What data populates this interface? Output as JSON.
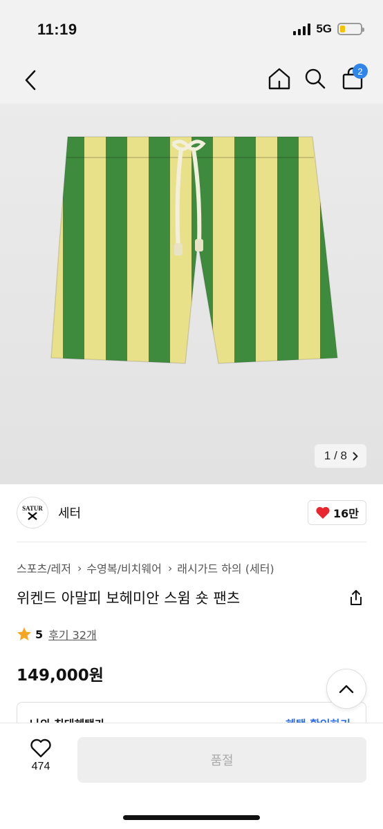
{
  "status_bar": {
    "time": "11:19",
    "network": "5G",
    "battery_level": 0.25
  },
  "nav": {
    "cart_count": "2"
  },
  "image": {
    "counter": "1 / 8",
    "stripe_colors": [
      "#e9e08a",
      "#3f8b3e"
    ]
  },
  "brand": {
    "logo_text": "SATUR",
    "name": "세터",
    "likes": "16만"
  },
  "breadcrumb": [
    "스포츠/레저",
    "수영복/비치웨어",
    "래시가드 하의 (세터)"
  ],
  "product": {
    "title": "위켄드 아말피 보헤미안 스윔 숏 팬츠",
    "rating": "5",
    "reviews": "후기 32개",
    "price": "149,000원"
  },
  "benefit": {
    "label": "나의 최대혜택가",
    "link": "혜택 확인하기"
  },
  "bottom": {
    "wish_count": "474",
    "buy_label": "품절"
  },
  "colors": {
    "heart_red": "#e8262d",
    "star": "#f5a623",
    "link_blue": "#2f6fe0",
    "badge_blue": "#2f86e8"
  }
}
